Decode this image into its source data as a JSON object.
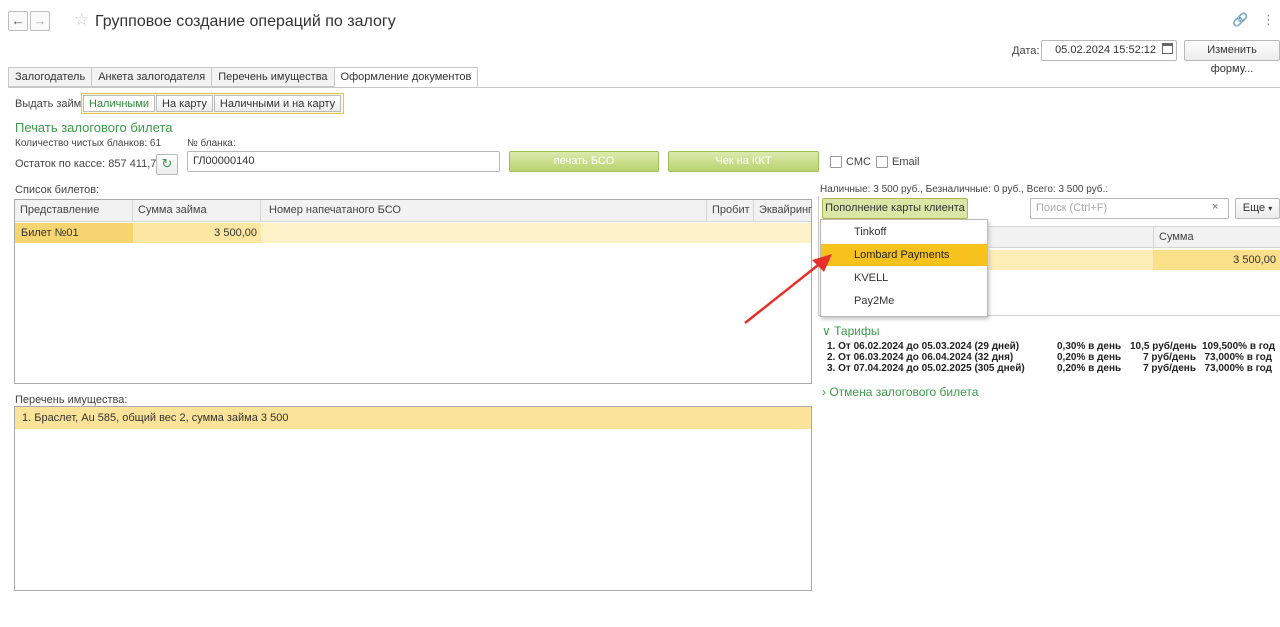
{
  "header": {
    "title": "Групповое создание операций по залогу",
    "date_label": "Дата:",
    "date_value": "05.02.2024 15:52:12",
    "change_form": "Изменить форму..."
  },
  "tabs": [
    {
      "label": "Залогодатель"
    },
    {
      "label": "Анкета залогодателя"
    },
    {
      "label": "Перечень имущества"
    },
    {
      "label": "Оформление документов"
    }
  ],
  "loan": {
    "label": "Выдать займ:",
    "options": [
      "Наличными",
      "На карту",
      "Наличными и на карту"
    ]
  },
  "print": {
    "heading": "Печать залогового билета",
    "blanks_count": "Количество чистых бланков: 61",
    "blank_no_label": "№ бланка:",
    "blank_no_value": "ГЛ00000140",
    "cash_balance": "Остаток по кассе: 857 411,72",
    "print_bso": "печать БСО",
    "kkt": "Чек на ККТ",
    "sms": "СМС",
    "email": "Email"
  },
  "tickets": {
    "label": "Список билетов:",
    "columns": [
      "Представление билета",
      "Сумма займа",
      "Номер напечатаного БСО",
      "Пробит",
      "Эквайринг"
    ],
    "rows": [
      {
        "name": "Билет №01",
        "amount": "3 500,00"
      }
    ]
  },
  "property": {
    "label": "Перечень имущества:",
    "items": [
      "1. Браслет, Au 585, общий вес 2, сумма займа 3 500"
    ]
  },
  "right": {
    "totals": "Наличные: 3 500 руб., Безналичные: 0 руб., Всего: 3 500 руб.:",
    "topup_button": "Пополнение карты клиента",
    "search_placeholder": "Поиск (Ctrl+F)",
    "more": "Еще",
    "col_sum": "Сумма",
    "row_sum": "3 500,00",
    "menu": [
      "Tinkoff",
      "Lombard Payments",
      "KVELL",
      "Pay2Me"
    ],
    "tariffs_heading": "Тарифы",
    "tariffs": [
      {
        "period": "1. От 06.02.2024 до 05.03.2024 (29 дней)",
        "rate": "0,30% в день",
        "per_day": "10,5 руб/день",
        "year": "109,500% в год"
      },
      {
        "period": "2. От 06.03.2024 до 06.04.2024 (32 дня)",
        "rate": "0,20% в день",
        "per_day": "7 руб/день",
        "year": "73,000% в год"
      },
      {
        "period": "3. От 07.04.2024 до 05.02.2025 (305 дней)",
        "rate": "0,20% в день",
        "per_day": "7 руб/день",
        "year": "73,000% в год"
      }
    ],
    "cancel_heading": "Отмена залогового билета"
  }
}
